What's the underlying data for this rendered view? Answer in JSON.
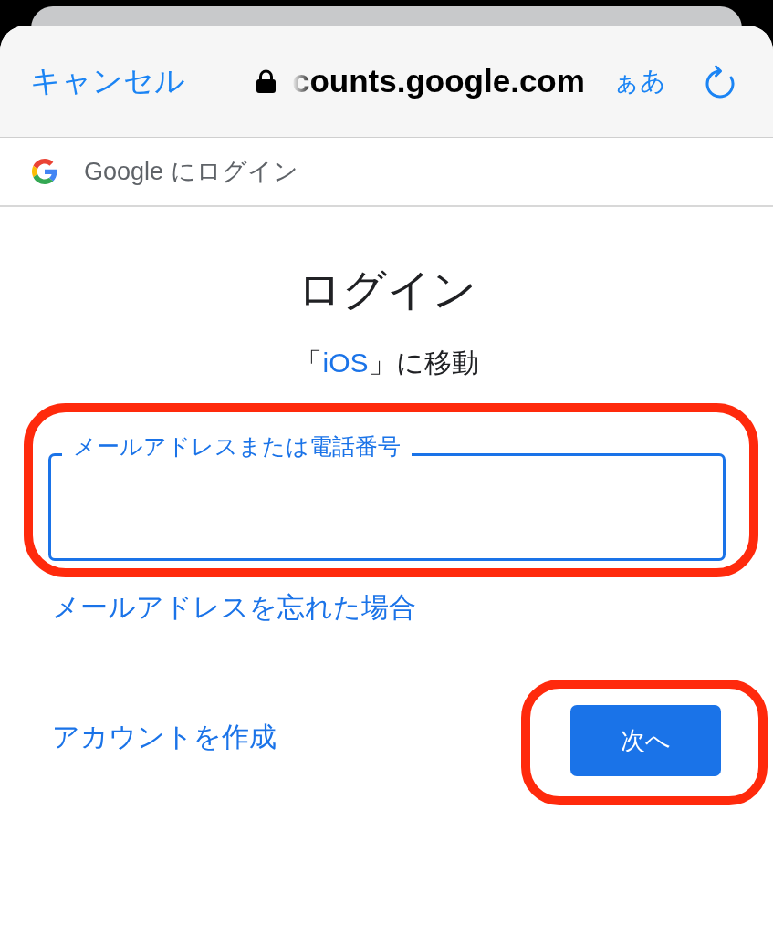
{
  "browser_bar": {
    "cancel": "キャンセル",
    "url": "counts.google.com",
    "text_size_button": "ぁあ"
  },
  "page_tab": {
    "title": "Google にログイン"
  },
  "login": {
    "title": "ログイン",
    "subtitle": {
      "prefix": "「",
      "link": "iOS",
      "suffix": "」に移動"
    },
    "email_field": {
      "label": "メールアドレスまたは電話番号",
      "focused": true,
      "highlighted": true
    },
    "forgot_link": "メールアドレスを忘れた場合",
    "create_account_link": "アカウントを作成",
    "next_button": {
      "label": "次へ",
      "highlighted": true
    }
  }
}
